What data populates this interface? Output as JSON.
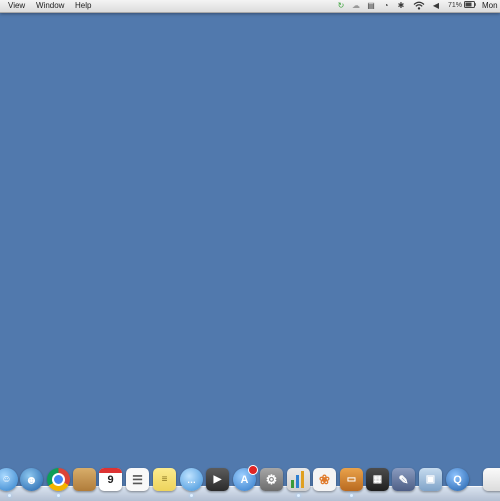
{
  "menubar": {
    "menus": [
      "View",
      "Window",
      "Help"
    ],
    "battery_text": "71%",
    "clock_text": "Mon"
  },
  "desktop": {
    "background_color": "#5179ad"
  },
  "dock": {
    "calendar_day": "9",
    "items": [
      {
        "name": "finder-icon",
        "bg": "#3f9be0"
      },
      {
        "name": "contacts-icon",
        "bg": "#2b7cc4"
      },
      {
        "name": "chrome-icon",
        "bg": "#ffffff"
      },
      {
        "name": "notebook-icon",
        "bg": "#c99a52"
      },
      {
        "name": "calendar-icon",
        "bg": "#ffffff"
      },
      {
        "name": "list-icon",
        "bg": "#f7f7f7"
      },
      {
        "name": "stickies-icon",
        "bg": "#f5e27a"
      },
      {
        "name": "messages-icon",
        "bg": "#5aa9ea"
      },
      {
        "name": "facetime-icon",
        "bg": "#4a4a4a"
      },
      {
        "name": "app-store-icon",
        "bg": "#3e8edb"
      },
      {
        "name": "system-preferences-icon",
        "bg": "#8b8b8b"
      },
      {
        "name": "numbers-icon",
        "bg": "#4aa14a"
      },
      {
        "name": "photo-icon",
        "bg": "#f2f2f2"
      },
      {
        "name": "keynote-icon",
        "bg": "#d98b32"
      },
      {
        "name": "calculator-icon",
        "bg": "#3c3c3c"
      },
      {
        "name": "script-editor-icon",
        "bg": "#6e7fa5"
      },
      {
        "name": "preview-icon",
        "bg": "#9cbbd8"
      },
      {
        "name": "quicktime-icon",
        "bg": "#2f6eb8"
      },
      {
        "name": "document-icon",
        "bg": "#f0f0f0"
      }
    ]
  }
}
